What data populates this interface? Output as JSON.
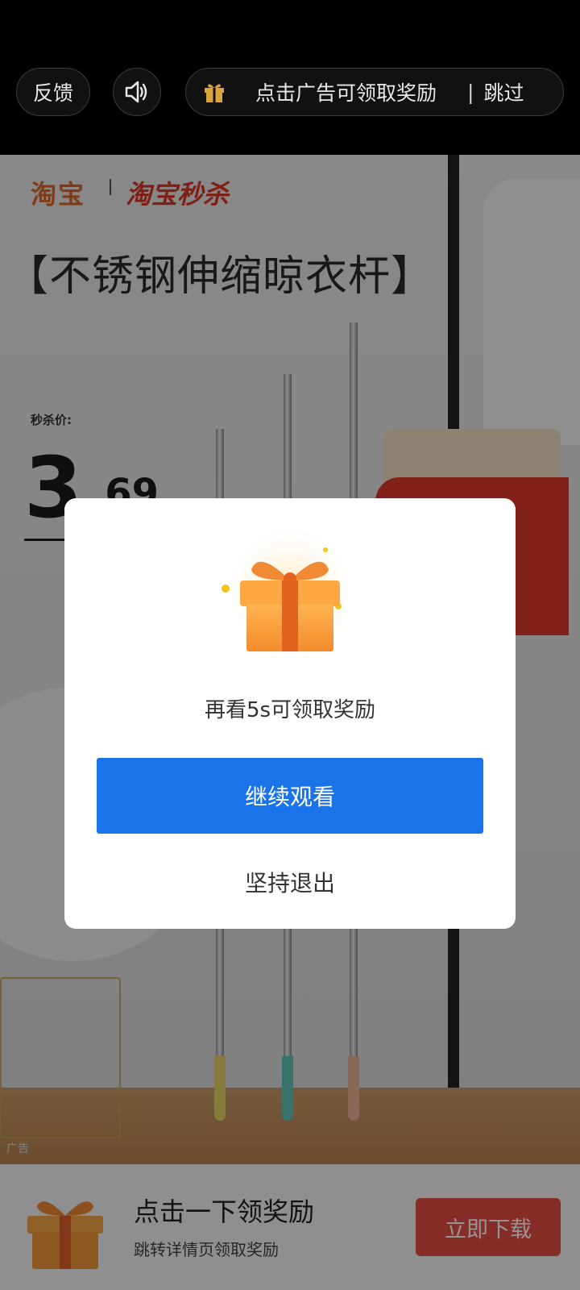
{
  "topbar": {
    "feedback_label": "反馈",
    "sound_icon": "speaker-icon",
    "reward_prompt": "点击广告可领取奖励",
    "separator": "|",
    "skip_label": "跳过"
  },
  "ad": {
    "brand_primary": "淘宝",
    "brand_secondary": "淘宝秒杀",
    "headline": "【不锈钢伸缩晾衣杆】",
    "price_label": "秒杀价:",
    "price_integer": "3",
    "price_decimal": ".69",
    "ad_tag": "广告"
  },
  "dialog": {
    "message": "再看5s可领取奖励",
    "continue_label": "继续观看",
    "quit_label": "坚持退出"
  },
  "bottom_banner": {
    "title": "点击一下领奖励",
    "subtitle": "跳转详情页领取奖励",
    "download_label": "立即下载"
  },
  "colors": {
    "primary_button": "#1a73e8",
    "download_button": "#e84f45",
    "gift_orange": "#f39a3a"
  }
}
